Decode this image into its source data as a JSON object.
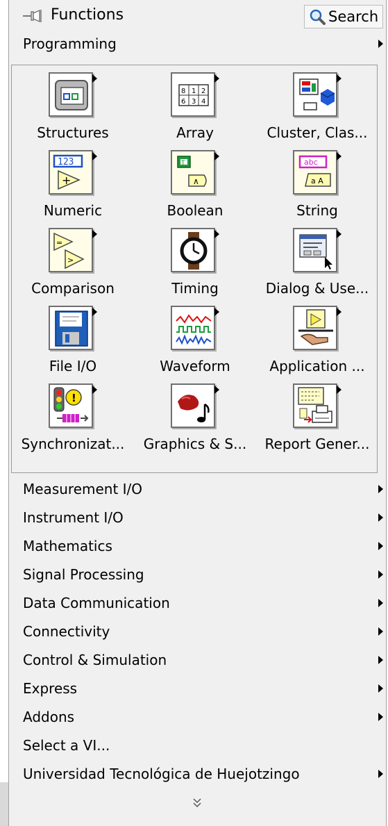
{
  "header": {
    "title": "Functions",
    "search_label": "Search"
  },
  "current_category": "Programming",
  "tiles": [
    {
      "label": "Structures",
      "icon": "structures-icon"
    },
    {
      "label": "Array",
      "icon": "array-icon"
    },
    {
      "label": "Cluster, Clas...",
      "icon": "cluster-icon"
    },
    {
      "label": "Numeric",
      "icon": "numeric-icon"
    },
    {
      "label": "Boolean",
      "icon": "boolean-icon"
    },
    {
      "label": "String",
      "icon": "string-icon"
    },
    {
      "label": "Comparison",
      "icon": "comparison-icon"
    },
    {
      "label": "Timing",
      "icon": "timing-icon"
    },
    {
      "label": "Dialog & Use...",
      "icon": "dialog-icon"
    },
    {
      "label": "File I/O",
      "icon": "file-io-icon"
    },
    {
      "label": "Waveform",
      "icon": "waveform-icon"
    },
    {
      "label": "Application ...",
      "icon": "application-control-icon"
    },
    {
      "label": "Synchronizat...",
      "icon": "synchronization-icon"
    },
    {
      "label": "Graphics & S...",
      "icon": "graphics-sound-icon"
    },
    {
      "label": "Report Gener...",
      "icon": "report-generation-icon"
    }
  ],
  "categories": [
    {
      "label": "Measurement I/O",
      "has_submenu": true
    },
    {
      "label": "Instrument I/O",
      "has_submenu": true
    },
    {
      "label": "Mathematics",
      "has_submenu": true
    },
    {
      "label": "Signal Processing",
      "has_submenu": true
    },
    {
      "label": "Data Communication",
      "has_submenu": true
    },
    {
      "label": "Connectivity",
      "has_submenu": true
    },
    {
      "label": "Control & Simulation",
      "has_submenu": true
    },
    {
      "label": "Express",
      "has_submenu": true
    },
    {
      "label": "Addons",
      "has_submenu": true
    },
    {
      "label": "Select a VI...",
      "has_submenu": false
    },
    {
      "label": "Universidad Tecnológica de Huejotzingo",
      "has_submenu": true
    }
  ],
  "footer": {
    "icon": "expand-more-chevron-icon"
  }
}
